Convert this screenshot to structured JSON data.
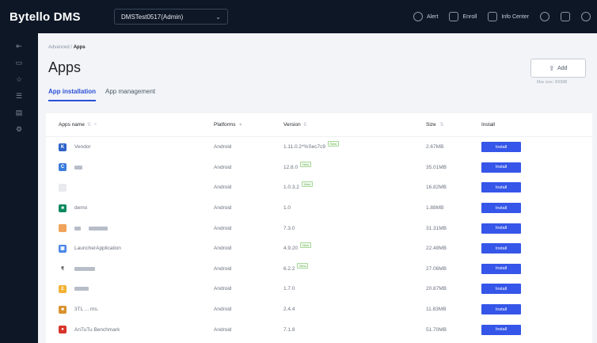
{
  "topbar": {
    "brand": "Bytello DMS",
    "tenant": "DMSTest0517(Admin)",
    "nav": [
      {
        "label": "Alert",
        "icon": "alert-icon"
      },
      {
        "label": "Enroll",
        "icon": "enroll-icon"
      },
      {
        "label": "Info Center",
        "icon": "info-center-icon"
      }
    ],
    "icons": [
      "globe-icon",
      "chat-icon",
      "user-icon"
    ]
  },
  "rail": {
    "items": [
      "expand-icon",
      "device-icon",
      "star-icon",
      "list-icon",
      "printer-icon",
      "settings-icon"
    ]
  },
  "breadcrumb": {
    "parent": "Advanced",
    "sep": "/",
    "current": "Apps"
  },
  "page": {
    "title": "Apps",
    "add_label": "Add",
    "max_note": "Max size: 300MB"
  },
  "tabs": [
    {
      "label": "App installation",
      "active": true
    },
    {
      "label": "App management",
      "active": false
    }
  ],
  "table": {
    "columns": {
      "name": "Apps name",
      "platforms": "Platforms",
      "version": "Version",
      "size": "Size",
      "install": "Install"
    },
    "install_label": "Install",
    "new_label": "New",
    "rows": [
      {
        "name": "Vendor",
        "platform": "Android",
        "version": "1.11.0.2*%Sec7c9",
        "new": true,
        "size": "2.67MB",
        "icon_color": "#2e63c9",
        "icon_glyph": "K"
      },
      {
        "name": "",
        "platform": "Android",
        "version": "12.8.0",
        "new": true,
        "size": "35.01MB",
        "icon_color": "#3b7ddd",
        "icon_glyph": "C"
      },
      {
        "name": "",
        "platform": "Android",
        "version": "1.0.3.2",
        "new": true,
        "size": "16.82MB",
        "icon_color": "#e8eaee",
        "icon_glyph": ""
      },
      {
        "name": "demo",
        "platform": "Android",
        "version": "1.0",
        "new": false,
        "size": "1.88MB",
        "icon_color": "#0f8a5f",
        "icon_glyph": "■"
      },
      {
        "name": "",
        "platform": "Android",
        "version": "7.3.0",
        "new": false,
        "size": "31.31MB",
        "icon_color": "#f0a35a",
        "icon_glyph": ""
      },
      {
        "name": "LauncherApplication",
        "platform": "Android",
        "version": "4.9.20",
        "new": true,
        "size": "22.48MB",
        "icon_color": "#4a86e8",
        "icon_glyph": "▣"
      },
      {
        "name": "",
        "platform": "Android",
        "version": "6.2.2",
        "new": true,
        "size": "27.06MB",
        "icon_color": "#ffffff",
        "icon_glyph": "₹"
      },
      {
        "name": "",
        "platform": "Android",
        "version": "1.7.0",
        "new": false,
        "size": "20.87MB",
        "icon_color": "#f2b233",
        "icon_glyph": "£"
      },
      {
        "name": "3TL ... ms.",
        "platform": "Android",
        "version": "2.4.4",
        "new": false,
        "size": "11.83MB",
        "icon_color": "#d9922e",
        "icon_glyph": "■"
      },
      {
        "name": "AnTuTu Benchmark",
        "platform": "Android",
        "version": "7.1.8",
        "new": false,
        "size": "51.70MB",
        "icon_color": "#d9342b",
        "icon_glyph": "●"
      }
    ]
  }
}
